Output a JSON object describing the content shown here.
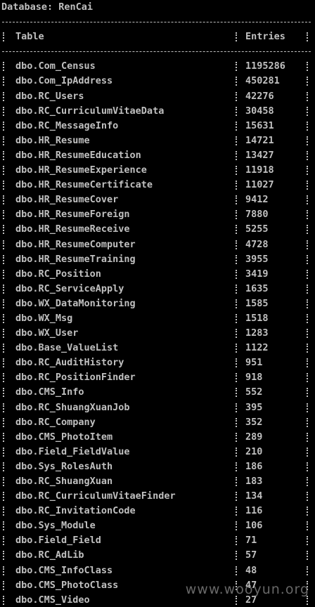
{
  "database": {
    "label": "Database: RenCai"
  },
  "table": {
    "headers": {
      "name": "Table",
      "count": "Entries"
    },
    "rows": [
      {
        "name": "dbo.Com_Census",
        "count": "1195286"
      },
      {
        "name": "dbo.Com_IpAddress",
        "count": "450281"
      },
      {
        "name": "dbo.RC_Users",
        "count": "42276"
      },
      {
        "name": "dbo.RC_CurriculumVitaeData",
        "count": "30458"
      },
      {
        "name": "dbo.RC_MessageInfo",
        "count": "15631"
      },
      {
        "name": "dbo.HR_Resume",
        "count": "14721"
      },
      {
        "name": "dbo.HR_ResumeEducation",
        "count": "13427"
      },
      {
        "name": "dbo.HR_ResumeExperience",
        "count": "11918"
      },
      {
        "name": "dbo.HR_ResumeCertificate",
        "count": "11027"
      },
      {
        "name": "dbo.HR_ResumeCover",
        "count": "9412"
      },
      {
        "name": "dbo.HR_ResumeForeign",
        "count": "7880"
      },
      {
        "name": "dbo.HR_ResumeReceive",
        "count": "5255"
      },
      {
        "name": "dbo.HR_ResumeComputer",
        "count": "4728"
      },
      {
        "name": "dbo.HR_ResumeTraining",
        "count": "3955"
      },
      {
        "name": "dbo.RC_Position",
        "count": "3419"
      },
      {
        "name": "dbo.RC_ServiceApply",
        "count": "1635"
      },
      {
        "name": "dbo.WX_DataMonitoring",
        "count": "1585"
      },
      {
        "name": "dbo.WX_Msg",
        "count": "1518"
      },
      {
        "name": "dbo.WX_User",
        "count": "1283"
      },
      {
        "name": "dbo.Base_ValueList",
        "count": "1122"
      },
      {
        "name": "dbo.RC_AuditHistory",
        "count": "951"
      },
      {
        "name": "dbo.RC_PositionFinder",
        "count": "918"
      },
      {
        "name": "dbo.CMS_Info",
        "count": "552"
      },
      {
        "name": "dbo.RC_ShuangXuanJob",
        "count": "395"
      },
      {
        "name": "dbo.RC_Company",
        "count": "352"
      },
      {
        "name": "dbo.CMS_PhotoItem",
        "count": "289"
      },
      {
        "name": "dbo.Field_FieldValue",
        "count": "210"
      },
      {
        "name": "dbo.Sys_RolesAuth",
        "count": "186"
      },
      {
        "name": "dbo.RC_ShuangXuan",
        "count": "183"
      },
      {
        "name": "dbo.RC_CurriculumVitaeFinder",
        "count": "134"
      },
      {
        "name": "dbo.RC_InvitationCode",
        "count": "116"
      },
      {
        "name": "dbo.Sys_Module",
        "count": "106"
      },
      {
        "name": "dbo.Field_Field",
        "count": "71"
      },
      {
        "name": "dbo.RC_AdLib",
        "count": "57"
      },
      {
        "name": "dbo.CMS_InfoClass",
        "count": "48"
      },
      {
        "name": "dbo.CMS_PhotoClass",
        "count": "47"
      },
      {
        "name": "dbo.CMS_Video",
        "count": "27"
      }
    ]
  },
  "watermark": {
    "text": "www.wooyun.org"
  },
  "colors": {
    "background": "#000000",
    "text": "#c0c0c0"
  }
}
